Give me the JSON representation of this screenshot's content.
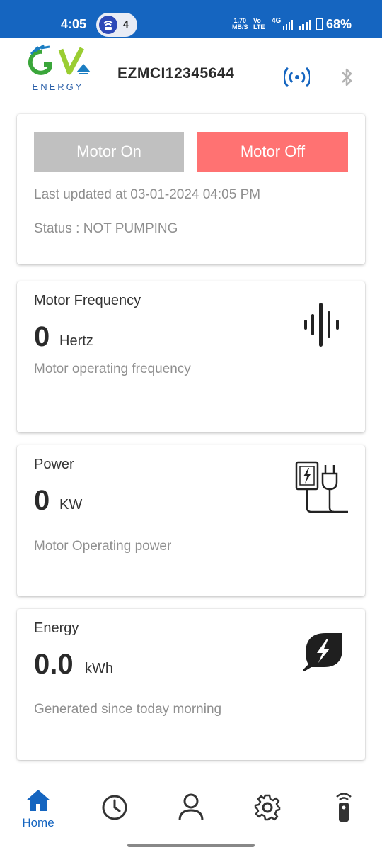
{
  "status_bar": {
    "time": "4:05",
    "notification_count": "4",
    "speed_value": "1.70",
    "speed_unit": "MB/S",
    "volte_top": "Vo",
    "volte_bottom": "LTE",
    "network": "4G",
    "battery": "68%"
  },
  "header": {
    "logo_text": "ENERGY",
    "device_id": "EZMCI12345644",
    "icons": [
      "wifi-signal-icon",
      "bluetooth-icon"
    ]
  },
  "motor_card": {
    "on_label": "Motor On",
    "off_label": "Motor Off",
    "last_updated": "Last updated at 03-01-2024 04:05 PM",
    "status": "Status : NOT PUMPING"
  },
  "metrics": [
    {
      "title": "Motor Frequency",
      "value": "0",
      "unit": "Hertz",
      "description": "Motor operating frequency",
      "icon": "frequency-icon"
    },
    {
      "title": "Power",
      "value": "0",
      "unit": "KW",
      "description": "Motor Operating power",
      "icon": "power-plug-icon"
    },
    {
      "title": "Energy",
      "value": "0.0",
      "unit": "kWh",
      "description": "Generated since today morning",
      "icon": "energy-leaf-icon"
    }
  ],
  "colors": {
    "status_bar": "#1565c0",
    "accent": "#1565c0",
    "motor_on": "#c0c0c0",
    "motor_off": "#ff7272"
  },
  "bottom_nav": [
    {
      "label": "Home",
      "icon": "home-icon",
      "active": true
    },
    {
      "label": "",
      "icon": "history-clock-icon",
      "active": false
    },
    {
      "label": "",
      "icon": "profile-icon",
      "active": false
    },
    {
      "label": "",
      "icon": "settings-gear-icon",
      "active": false
    },
    {
      "label": "",
      "icon": "remote-icon",
      "active": false
    }
  ]
}
